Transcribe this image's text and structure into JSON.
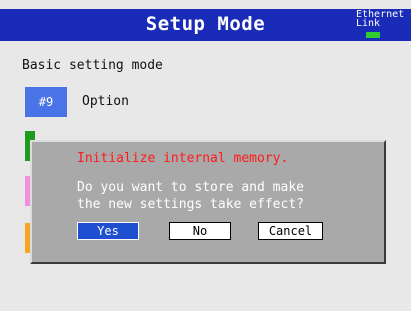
{
  "header": {
    "title": "Setup Mode",
    "ethernet_line1": "Ethernet",
    "ethernet_line2": "Link",
    "link_led_color": "#2ecc2e"
  },
  "main": {
    "heading": "Basic setting mode",
    "selected_item": {
      "number": "#9",
      "label": "Option"
    },
    "tile_colors": [
      "#1e9a1e",
      "#f08fe0",
      "#f5a623"
    ]
  },
  "dialog": {
    "title": "Initialize internal memory.",
    "message_line1": "Do you want to store and make",
    "message_line2": "the new settings take effect?",
    "buttons": {
      "yes": "Yes",
      "no": "No",
      "cancel": "Cancel"
    },
    "title_color": "#ff1a1a"
  },
  "colors": {
    "titlebar": "#1a2bb8",
    "selected_button": "#1f4fd1",
    "background": "#e8e8e8",
    "dialog_background": "#a9a9a9"
  }
}
